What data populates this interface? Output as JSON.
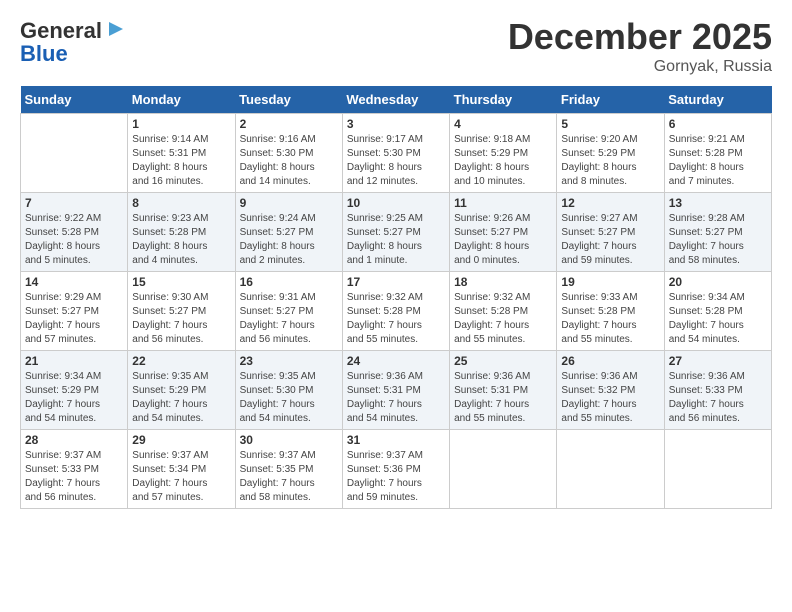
{
  "header": {
    "logo_line1": "General",
    "logo_line2": "Blue",
    "month_title": "December 2025",
    "location": "Gornyak, Russia"
  },
  "days_of_week": [
    "Sunday",
    "Monday",
    "Tuesday",
    "Wednesday",
    "Thursday",
    "Friday",
    "Saturday"
  ],
  "weeks": [
    [
      {
        "day": "",
        "info": ""
      },
      {
        "day": "1",
        "info": "Sunrise: 9:14 AM\nSunset: 5:31 PM\nDaylight: 8 hours\nand 16 minutes."
      },
      {
        "day": "2",
        "info": "Sunrise: 9:16 AM\nSunset: 5:30 PM\nDaylight: 8 hours\nand 14 minutes."
      },
      {
        "day": "3",
        "info": "Sunrise: 9:17 AM\nSunset: 5:30 PM\nDaylight: 8 hours\nand 12 minutes."
      },
      {
        "day": "4",
        "info": "Sunrise: 9:18 AM\nSunset: 5:29 PM\nDaylight: 8 hours\nand 10 minutes."
      },
      {
        "day": "5",
        "info": "Sunrise: 9:20 AM\nSunset: 5:29 PM\nDaylight: 8 hours\nand 8 minutes."
      },
      {
        "day": "6",
        "info": "Sunrise: 9:21 AM\nSunset: 5:28 PM\nDaylight: 8 hours\nand 7 minutes."
      }
    ],
    [
      {
        "day": "7",
        "info": "Sunrise: 9:22 AM\nSunset: 5:28 PM\nDaylight: 8 hours\nand 5 minutes."
      },
      {
        "day": "8",
        "info": "Sunrise: 9:23 AM\nSunset: 5:28 PM\nDaylight: 8 hours\nand 4 minutes."
      },
      {
        "day": "9",
        "info": "Sunrise: 9:24 AM\nSunset: 5:27 PM\nDaylight: 8 hours\nand 2 minutes."
      },
      {
        "day": "10",
        "info": "Sunrise: 9:25 AM\nSunset: 5:27 PM\nDaylight: 8 hours\nand 1 minute."
      },
      {
        "day": "11",
        "info": "Sunrise: 9:26 AM\nSunset: 5:27 PM\nDaylight: 8 hours\nand 0 minutes."
      },
      {
        "day": "12",
        "info": "Sunrise: 9:27 AM\nSunset: 5:27 PM\nDaylight: 7 hours\nand 59 minutes."
      },
      {
        "day": "13",
        "info": "Sunrise: 9:28 AM\nSunset: 5:27 PM\nDaylight: 7 hours\nand 58 minutes."
      }
    ],
    [
      {
        "day": "14",
        "info": "Sunrise: 9:29 AM\nSunset: 5:27 PM\nDaylight: 7 hours\nand 57 minutes."
      },
      {
        "day": "15",
        "info": "Sunrise: 9:30 AM\nSunset: 5:27 PM\nDaylight: 7 hours\nand 56 minutes."
      },
      {
        "day": "16",
        "info": "Sunrise: 9:31 AM\nSunset: 5:27 PM\nDaylight: 7 hours\nand 56 minutes."
      },
      {
        "day": "17",
        "info": "Sunrise: 9:32 AM\nSunset: 5:28 PM\nDaylight: 7 hours\nand 55 minutes."
      },
      {
        "day": "18",
        "info": "Sunrise: 9:32 AM\nSunset: 5:28 PM\nDaylight: 7 hours\nand 55 minutes."
      },
      {
        "day": "19",
        "info": "Sunrise: 9:33 AM\nSunset: 5:28 PM\nDaylight: 7 hours\nand 55 minutes."
      },
      {
        "day": "20",
        "info": "Sunrise: 9:34 AM\nSunset: 5:28 PM\nDaylight: 7 hours\nand 54 minutes."
      }
    ],
    [
      {
        "day": "21",
        "info": "Sunrise: 9:34 AM\nSunset: 5:29 PM\nDaylight: 7 hours\nand 54 minutes."
      },
      {
        "day": "22",
        "info": "Sunrise: 9:35 AM\nSunset: 5:29 PM\nDaylight: 7 hours\nand 54 minutes."
      },
      {
        "day": "23",
        "info": "Sunrise: 9:35 AM\nSunset: 5:30 PM\nDaylight: 7 hours\nand 54 minutes."
      },
      {
        "day": "24",
        "info": "Sunrise: 9:36 AM\nSunset: 5:31 PM\nDaylight: 7 hours\nand 54 minutes."
      },
      {
        "day": "25",
        "info": "Sunrise: 9:36 AM\nSunset: 5:31 PM\nDaylight: 7 hours\nand 55 minutes."
      },
      {
        "day": "26",
        "info": "Sunrise: 9:36 AM\nSunset: 5:32 PM\nDaylight: 7 hours\nand 55 minutes."
      },
      {
        "day": "27",
        "info": "Sunrise: 9:36 AM\nSunset: 5:33 PM\nDaylight: 7 hours\nand 56 minutes."
      }
    ],
    [
      {
        "day": "28",
        "info": "Sunrise: 9:37 AM\nSunset: 5:33 PM\nDaylight: 7 hours\nand 56 minutes."
      },
      {
        "day": "29",
        "info": "Sunrise: 9:37 AM\nSunset: 5:34 PM\nDaylight: 7 hours\nand 57 minutes."
      },
      {
        "day": "30",
        "info": "Sunrise: 9:37 AM\nSunset: 5:35 PM\nDaylight: 7 hours\nand 58 minutes."
      },
      {
        "day": "31",
        "info": "Sunrise: 9:37 AM\nSunset: 5:36 PM\nDaylight: 7 hours\nand 59 minutes."
      },
      {
        "day": "",
        "info": ""
      },
      {
        "day": "",
        "info": ""
      },
      {
        "day": "",
        "info": ""
      }
    ]
  ]
}
